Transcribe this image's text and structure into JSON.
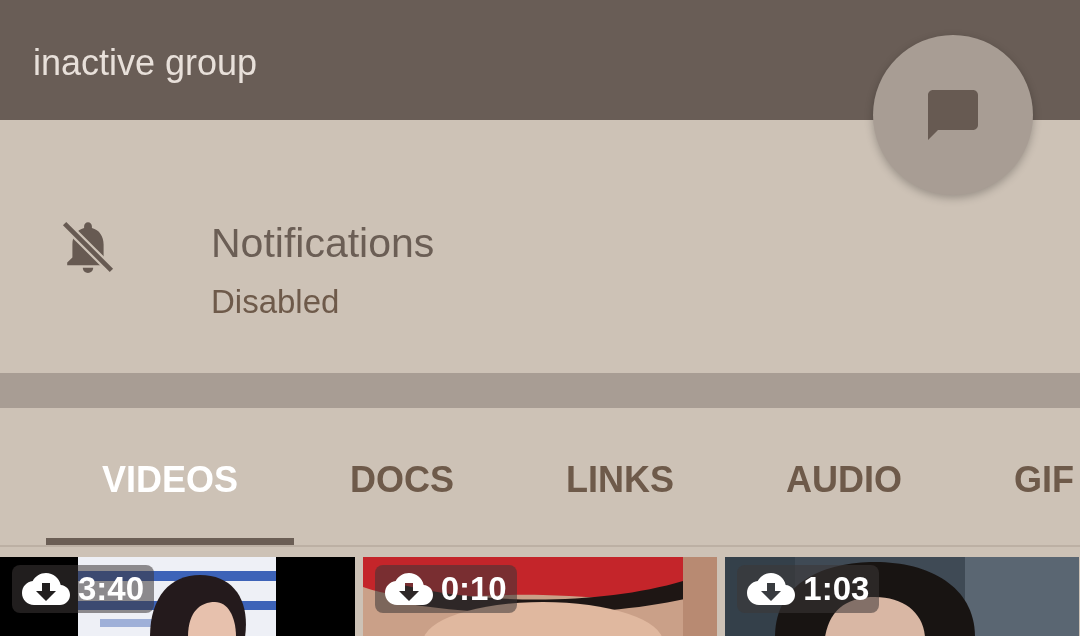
{
  "header": {
    "subtitle": "inactive group"
  },
  "notifications": {
    "label": "Notifications",
    "value": "Disabled",
    "enabled": false
  },
  "tabs": [
    {
      "label": "VIDEOS",
      "selected": true
    },
    {
      "label": "DOCS",
      "selected": false
    },
    {
      "label": "LINKS",
      "selected": false
    },
    {
      "label": "AUDIO",
      "selected": false
    },
    {
      "label": "GIF",
      "selected": false
    }
  ],
  "media": [
    {
      "kind": "picture",
      "duration": "3:40"
    },
    {
      "kind": "picture",
      "duration": "0:10"
    },
    {
      "kind": "picture",
      "duration": "1:03"
    }
  ]
}
